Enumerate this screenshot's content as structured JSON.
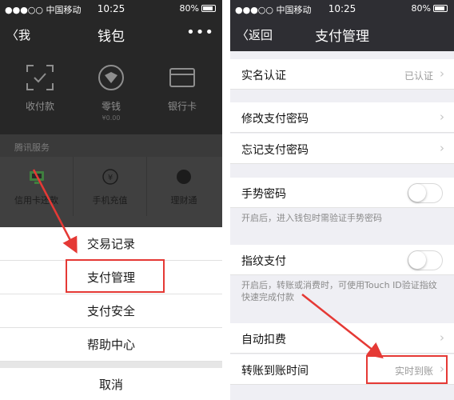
{
  "colors": {
    "accent": "#e53935",
    "dark_bg": "#272727",
    "list_bg": "#efeff4"
  },
  "left": {
    "status": {
      "carrier": "●●●○○ 中国移动",
      "time": "10:25",
      "battery": "80%"
    },
    "nav": {
      "back": "我",
      "title": "钱包",
      "more": "•••"
    },
    "tiles": [
      {
        "label": "收付款",
        "icon": "scan-icon"
      },
      {
        "label": "零钱",
        "sub": "¥0.00",
        "icon": "coin-icon"
      },
      {
        "label": "银行卡",
        "icon": "card-icon"
      }
    ],
    "section": "腾讯服务",
    "services": [
      {
        "label": "信用卡还款",
        "icon": "card-repay-icon"
      },
      {
        "label": "手机充值",
        "icon": "yuan-icon"
      },
      {
        "label": "理财通",
        "icon": "finance-icon"
      }
    ],
    "sheet": [
      "交易记录",
      "支付管理",
      "支付安全",
      "帮助中心"
    ],
    "cancel": "取消"
  },
  "right": {
    "status": {
      "carrier": "●●●○○ 中国移动",
      "time": "10:25",
      "battery": "80%"
    },
    "nav": {
      "back": "返回",
      "title": "支付管理"
    },
    "realname": {
      "label": "实名认证",
      "value": "已认证"
    },
    "change_pw": "修改支付密码",
    "forgot_pw": "忘记支付密码",
    "gesture": {
      "label": "手势密码",
      "note": "开启后，进入钱包时需验证手势密码"
    },
    "touch": {
      "label": "指纹支付",
      "note": "开启后，转账或消费时，可使用Touch ID验证指纹快速完成付款"
    },
    "auto_deduct": "自动扣费",
    "transfer_time": {
      "label": "转账到账时间",
      "value": "实时到账"
    }
  }
}
